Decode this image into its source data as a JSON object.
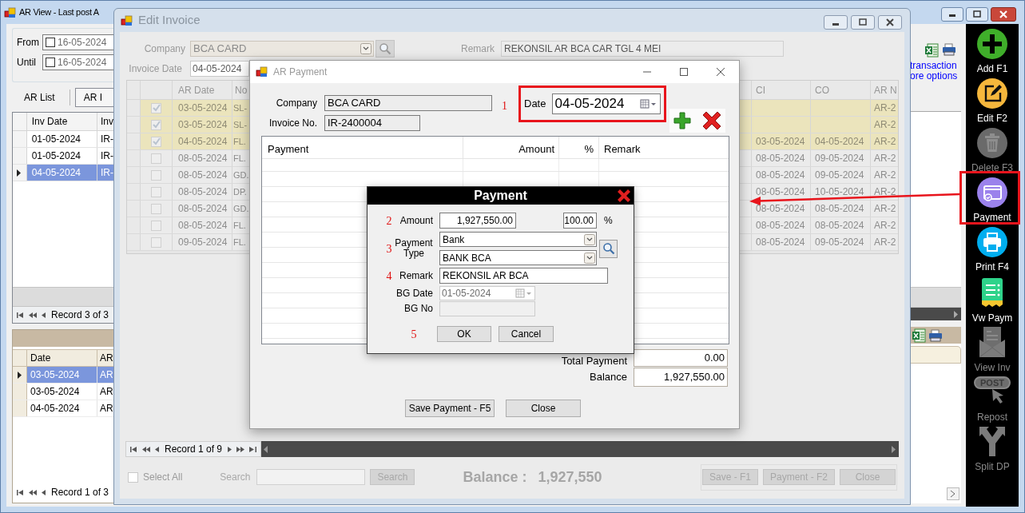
{
  "ar_view": {
    "title": "AR View - Last post A",
    "date_filters": [
      {
        "label": "From",
        "checked": false,
        "value": "16-05-2024"
      },
      {
        "label": "Until",
        "checked": false,
        "value": "16-05-2024"
      }
    ],
    "tabs": [
      {
        "label": "AR List",
        "selected": false
      },
      {
        "label": "AR I",
        "selected": true
      }
    ],
    "invoice_grid": {
      "columns": [
        "Inv Date",
        "Inv"
      ],
      "rows": [
        {
          "selected": false,
          "cells": [
            "01-05-2024",
            "IR-"
          ]
        },
        {
          "selected": false,
          "cells": [
            "01-05-2024",
            "IR-"
          ]
        },
        {
          "selected": true,
          "cells": [
            "04-05-2024",
            "IR-"
          ]
        }
      ],
      "navigator": "Record 3 of 3"
    },
    "ar_grid": {
      "columns": [
        "Date",
        "AR"
      ],
      "rows": [
        {
          "selected": true,
          "cells": [
            "03-05-2024",
            "AR"
          ]
        },
        {
          "selected": false,
          "cells": [
            "03-05-2024",
            "AR"
          ]
        },
        {
          "selected": false,
          "cells": [
            "04-05-2024",
            "AR"
          ]
        }
      ],
      "navigator": "Record 1 of 3"
    },
    "links": [
      "transaction",
      "ore options"
    ],
    "toolbar": [
      {
        "kind": "add",
        "label": "Add F1",
        "disabled": false,
        "highlighted": false
      },
      {
        "kind": "edit",
        "label": "Edit F2",
        "disabled": false,
        "highlighted": false
      },
      {
        "kind": "delete",
        "label": "Delete F3",
        "disabled": true,
        "highlighted": false
      },
      {
        "kind": "payment",
        "label": "Payment",
        "disabled": false,
        "highlighted": true
      },
      {
        "kind": "print",
        "label": "Print F4",
        "disabled": false,
        "highlighted": false
      },
      {
        "kind": "view_payment",
        "label": "Vw Paym",
        "disabled": false,
        "highlighted": false
      },
      {
        "kind": "view_invoice",
        "label": "View Inv",
        "disabled": true,
        "highlighted": false
      },
      {
        "kind": "repost",
        "label": "Repost",
        "badge": "POST",
        "disabled": true,
        "highlighted": false
      },
      {
        "kind": "split",
        "label": "Split DP",
        "disabled": true,
        "highlighted": false
      }
    ]
  },
  "edit_invoice": {
    "title": "Edit Invoice",
    "company": {
      "label": "Company",
      "value": "BCA CARD"
    },
    "remark": {
      "label": "Remark",
      "value": "REKONSIL AR BCA CAR TGL 4 MEI"
    },
    "invoice_date": {
      "label": "Invoice Date",
      "value": "04-05-2024"
    },
    "grid": {
      "columns": [
        "AR Date",
        "No",
        "CI",
        "CO",
        "AR N"
      ],
      "rows": [
        {
          "checked": true,
          "cells": [
            "03-05-2024",
            "SL-",
            "",
            "",
            "AR-2"
          ]
        },
        {
          "checked": true,
          "cells": [
            "03-05-2024",
            "SL-",
            "",
            "",
            "AR-2"
          ]
        },
        {
          "checked": true,
          "cells": [
            "04-05-2024",
            "FL.",
            "03-05-2024",
            "04-05-2024",
            "AR-2"
          ]
        },
        {
          "checked": false,
          "cells": [
            "08-05-2024",
            "FL.",
            "08-05-2024",
            "09-05-2024",
            "AR-2"
          ]
        },
        {
          "checked": false,
          "cells": [
            "08-05-2024",
            "GD.",
            "08-05-2024",
            "09-05-2024",
            "AR-2"
          ]
        },
        {
          "checked": false,
          "cells": [
            "08-05-2024",
            "DP.",
            "08-05-2024",
            "10-05-2024",
            "AR-2"
          ]
        },
        {
          "checked": false,
          "cells": [
            "08-05-2024",
            "GD.",
            "08-05-2024",
            "08-05-2024",
            "AR-2"
          ]
        },
        {
          "checked": false,
          "cells": [
            "08-05-2024",
            "FL.",
            "08-05-2024",
            "08-05-2024",
            "AR-2"
          ]
        },
        {
          "checked": false,
          "cells": [
            "09-05-2024",
            "FL.",
            "08-05-2024",
            "09-05-2024",
            "AR-2"
          ]
        }
      ],
      "navigator": "Record 1 of 9"
    },
    "select_all": {
      "label": "Select All",
      "checked": false
    },
    "search": {
      "label": "Search",
      "button": "Search",
      "disabled": true
    },
    "balance": {
      "label": "Balance :",
      "value": "1,927,550"
    },
    "buttons": [
      {
        "label": "Save - F1",
        "disabled": true
      },
      {
        "label": "Payment - F2",
        "disabled": true
      },
      {
        "label": "Close",
        "disabled": true
      }
    ]
  },
  "ar_payment": {
    "title": "AR Payment",
    "company": {
      "label": "Company",
      "value": "BCA CARD"
    },
    "invoice_no": {
      "label": "Invoice No.",
      "value": "IR-2400004"
    },
    "date": {
      "step": "1",
      "label": "Date",
      "value": "04-05-2024",
      "highlighted": true
    },
    "grid": {
      "columns": [
        "Payment",
        "Amount",
        "%",
        "Remark"
      ]
    },
    "total_payment": {
      "label": "Total Payment",
      "value": "0.00"
    },
    "balance": {
      "label": "Balance",
      "value": "1,927,550.00"
    },
    "buttons": [
      "Save Payment - F5",
      "Close"
    ]
  },
  "payment_dialog": {
    "title": "Payment",
    "amount": {
      "step": "2",
      "label": "Amount",
      "value": "1,927,550.00",
      "percent": "100.00",
      "percent_sign": "%"
    },
    "payment_type": {
      "step": "3",
      "label": "Payment Type",
      "value": "Bank",
      "account": "BANK BCA"
    },
    "remark": {
      "step": "4",
      "label": "Remark",
      "value": "REKONSIL AR BCA"
    },
    "bg_date": {
      "label": "BG Date",
      "value": "01-05-2024",
      "disabled": true
    },
    "bg_no": {
      "label": "BG No",
      "disabled": true
    },
    "buttons_step": "5",
    "ok": "OK",
    "cancel": "Cancel"
  }
}
